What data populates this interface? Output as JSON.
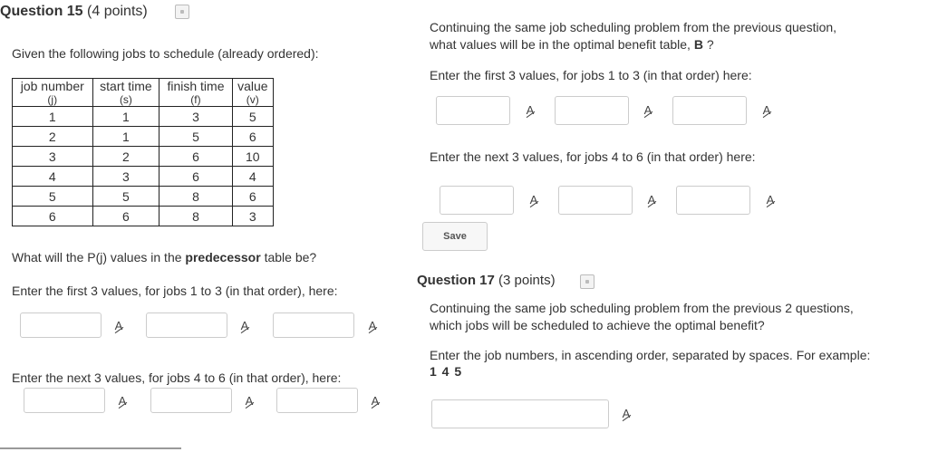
{
  "q15": {
    "title": "Question 15",
    "points": "(4 points)",
    "intro": "Given the following jobs to schedule (already ordered):",
    "table": {
      "headers": [
        "job number",
        "start time",
        "finish time",
        "value"
      ],
      "subheaders": [
        "(j)",
        "(s)",
        "(f)",
        "(v)"
      ],
      "rows": [
        [
          "1",
          "1",
          "3",
          "5"
        ],
        [
          "2",
          "1",
          "5",
          "6"
        ],
        [
          "3",
          "2",
          "6",
          "10"
        ],
        [
          "4",
          "3",
          "6",
          "4"
        ],
        [
          "5",
          "5",
          "8",
          "6"
        ],
        [
          "6",
          "6",
          "8",
          "3"
        ]
      ]
    },
    "pj_question_pre": "What will the P(j) values in the ",
    "pj_question_bold": "predecessor",
    "pj_question_post": " table be?",
    "first3": "Enter the first 3 values, for jobs 1 to 3 (in that order), here:",
    "next3": "Enter the next 3 values, for jobs 4 to 6 (in that order), here:"
  },
  "q16": {
    "prompt_line1": "Continuing the same job scheduling problem from the previous question,",
    "prompt_line2_pre": "what values will be in the optimal benefit table, ",
    "prompt_line2_bold": "B",
    "prompt_line2_post": " ?",
    "first3": "Enter the first 3 values, for jobs 1 to 3 (in that order) here:",
    "next3": "Enter the next 3 values, for jobs 4 to 6 (in that order) here:",
    "save_label": "Save"
  },
  "q17": {
    "title": "Question 17",
    "points": "(3 points)",
    "prompt_line1": "Continuing the same job scheduling problem from the previous 2 questions,",
    "prompt_line2": "which jobs will be scheduled to achieve the optimal benefit?",
    "instr_line1": "Enter the job numbers, in ascending order, separated by spaces. For example:",
    "example": "1 4 5"
  },
  "icons": {
    "save": "save-draft-icon",
    "spellcheck": "spellcheck-icon"
  }
}
